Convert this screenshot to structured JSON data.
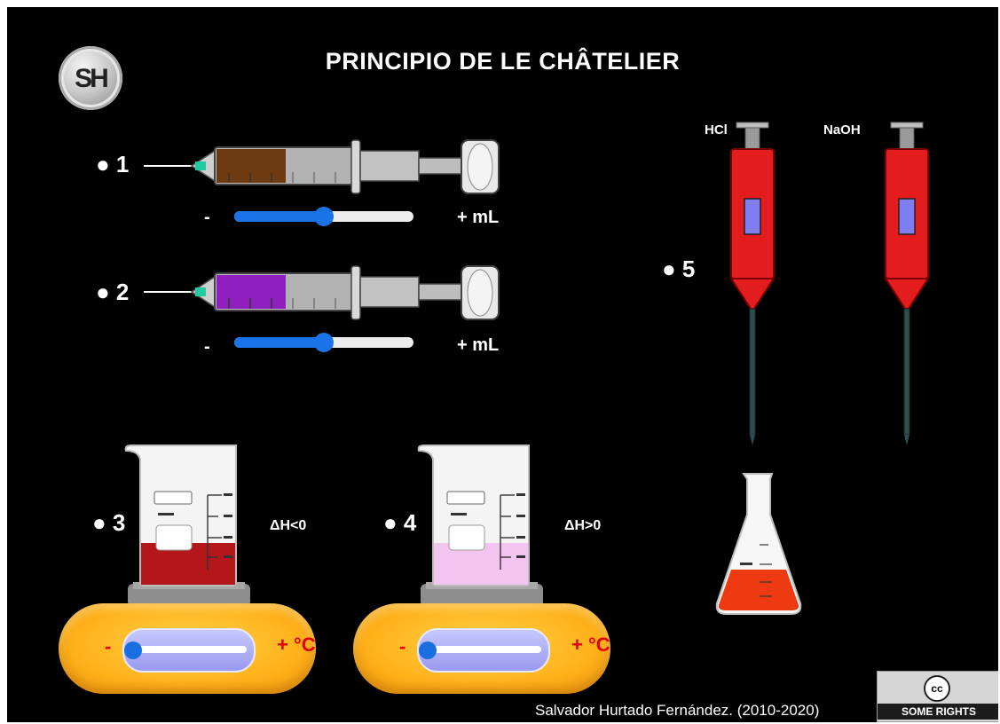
{
  "app": {
    "logo_text": "SH",
    "title": "PRINCIPIO DE LE CHÂTELIER"
  },
  "syringes": [
    {
      "number": "● 1",
      "minus": "-",
      "plus": "+ mL",
      "liquid_color": "#6e3a12",
      "level": 0.5
    },
    {
      "number": "● 2",
      "minus": "-",
      "plus": "+ mL",
      "liquid_color": "#8f1fbf",
      "level": 0.5
    }
  ],
  "beakers": [
    {
      "number": "● 3",
      "enthalpy": "ΔH<0",
      "liquid_color": "#b3171c",
      "heater_minus": "-",
      "heater_plus": "+ °C",
      "temperature_level": 0.0
    },
    {
      "number": "● 4",
      "enthalpy": "ΔH>0",
      "liquid_color": "#f3c4ef",
      "heater_minus": "-",
      "heater_plus": "+ °C",
      "temperature_level": 0.0
    }
  ],
  "pipettes": {
    "number": "● 5",
    "items": [
      {
        "label": "HCl",
        "color": "#e31d1d"
      },
      {
        "label": "NaOH",
        "color": "#e31d1d"
      }
    ]
  },
  "flask": {
    "liquid_color": "#ee3a12"
  },
  "footer": {
    "credit": "Salvador Hurtado Fernández. (2010-2020)",
    "license_symbol": "cc",
    "license_text": "SOME RIGHTS RESERVED"
  }
}
